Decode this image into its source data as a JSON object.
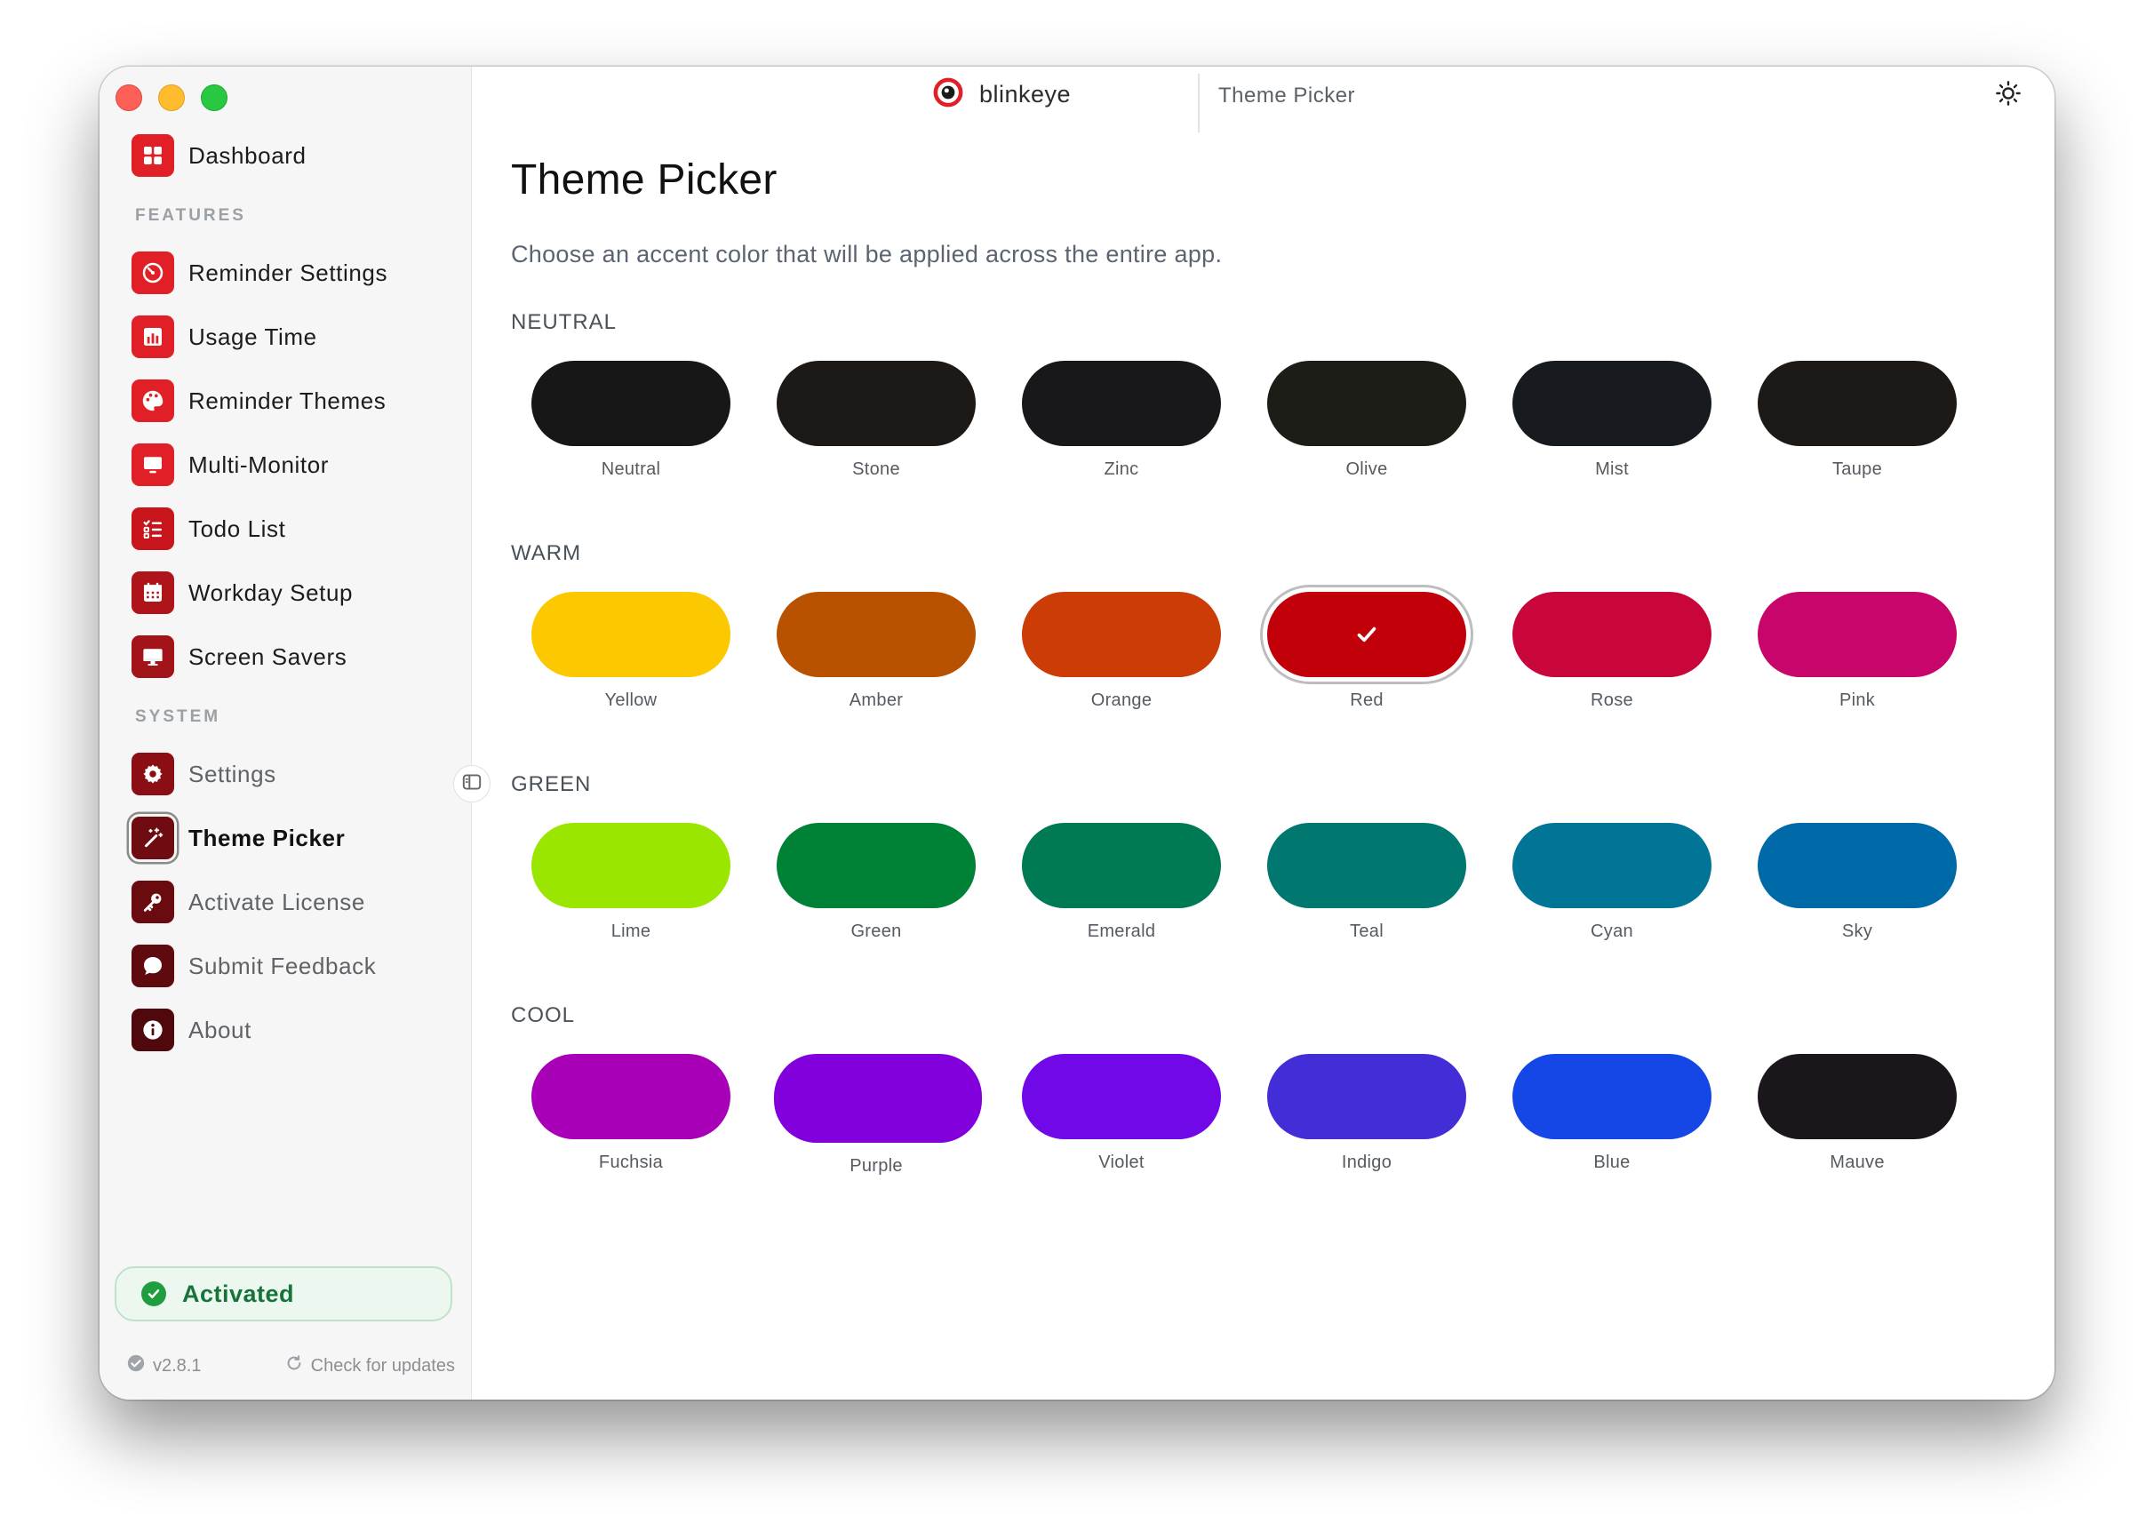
{
  "app": {
    "name": "blinkeye",
    "page": "Theme Picker"
  },
  "sidebar": {
    "dashboard": "Dashboard",
    "features_label": "FEATURES",
    "features": [
      "Reminder Settings",
      "Usage Time",
      "Reminder Themes",
      "Multi-Monitor",
      "Todo List",
      "Workday Setup",
      "Screen Savers"
    ],
    "system_label": "SYSTEM",
    "system": [
      "Settings",
      "Theme Picker",
      "Activate License",
      "Submit Feedback",
      "About"
    ],
    "active_item": "Theme Picker",
    "status": "Activated",
    "version": "v2.8.1",
    "check_updates": "Check for updates"
  },
  "main": {
    "title": "Theme Picker",
    "description": "Choose an accent color that will be applied across the entire app.",
    "selected": "Red",
    "groups": [
      {
        "label": "NEUTRAL",
        "swatches": [
          {
            "name": "Neutral",
            "color": "#171717"
          },
          {
            "name": "Stone",
            "color": "#1c1917"
          },
          {
            "name": "Zinc",
            "color": "#18181b"
          },
          {
            "name": "Olive",
            "color": "#1d1d17"
          },
          {
            "name": "Mist",
            "color": "#171a1e"
          },
          {
            "name": "Taupe",
            "color": "#1d1917"
          }
        ]
      },
      {
        "label": "WARM",
        "swatches": [
          {
            "name": "Yellow",
            "color": "#fcc800"
          },
          {
            "name": "Amber",
            "color": "#b95200"
          },
          {
            "name": "Orange",
            "color": "#cc3c06"
          },
          {
            "name": "Red",
            "color": "#c20009"
          },
          {
            "name": "Rose",
            "color": "#c8063a"
          },
          {
            "name": "Pink",
            "color": "#c8056a"
          }
        ]
      },
      {
        "label": "GREEN",
        "swatches": [
          {
            "name": "Lime",
            "color": "#9ae600"
          },
          {
            "name": "Green",
            "color": "#008236"
          },
          {
            "name": "Emerald",
            "color": "#007a55"
          },
          {
            "name": "Teal",
            "color": "#00786f"
          },
          {
            "name": "Cyan",
            "color": "#007595"
          },
          {
            "name": "Sky",
            "color": "#0069a8"
          }
        ]
      },
      {
        "label": "COOL",
        "swatches": [
          {
            "name": "Fuchsia",
            "color": "#a800b7"
          },
          {
            "name": "Purple",
            "color": "#8200db"
          },
          {
            "name": "Violet",
            "color": "#7008e7"
          },
          {
            "name": "Indigo",
            "color": "#432dd7"
          },
          {
            "name": "Blue",
            "color": "#1447e6"
          },
          {
            "name": "Mauve",
            "color": "#1a161c"
          }
        ]
      }
    ]
  }
}
